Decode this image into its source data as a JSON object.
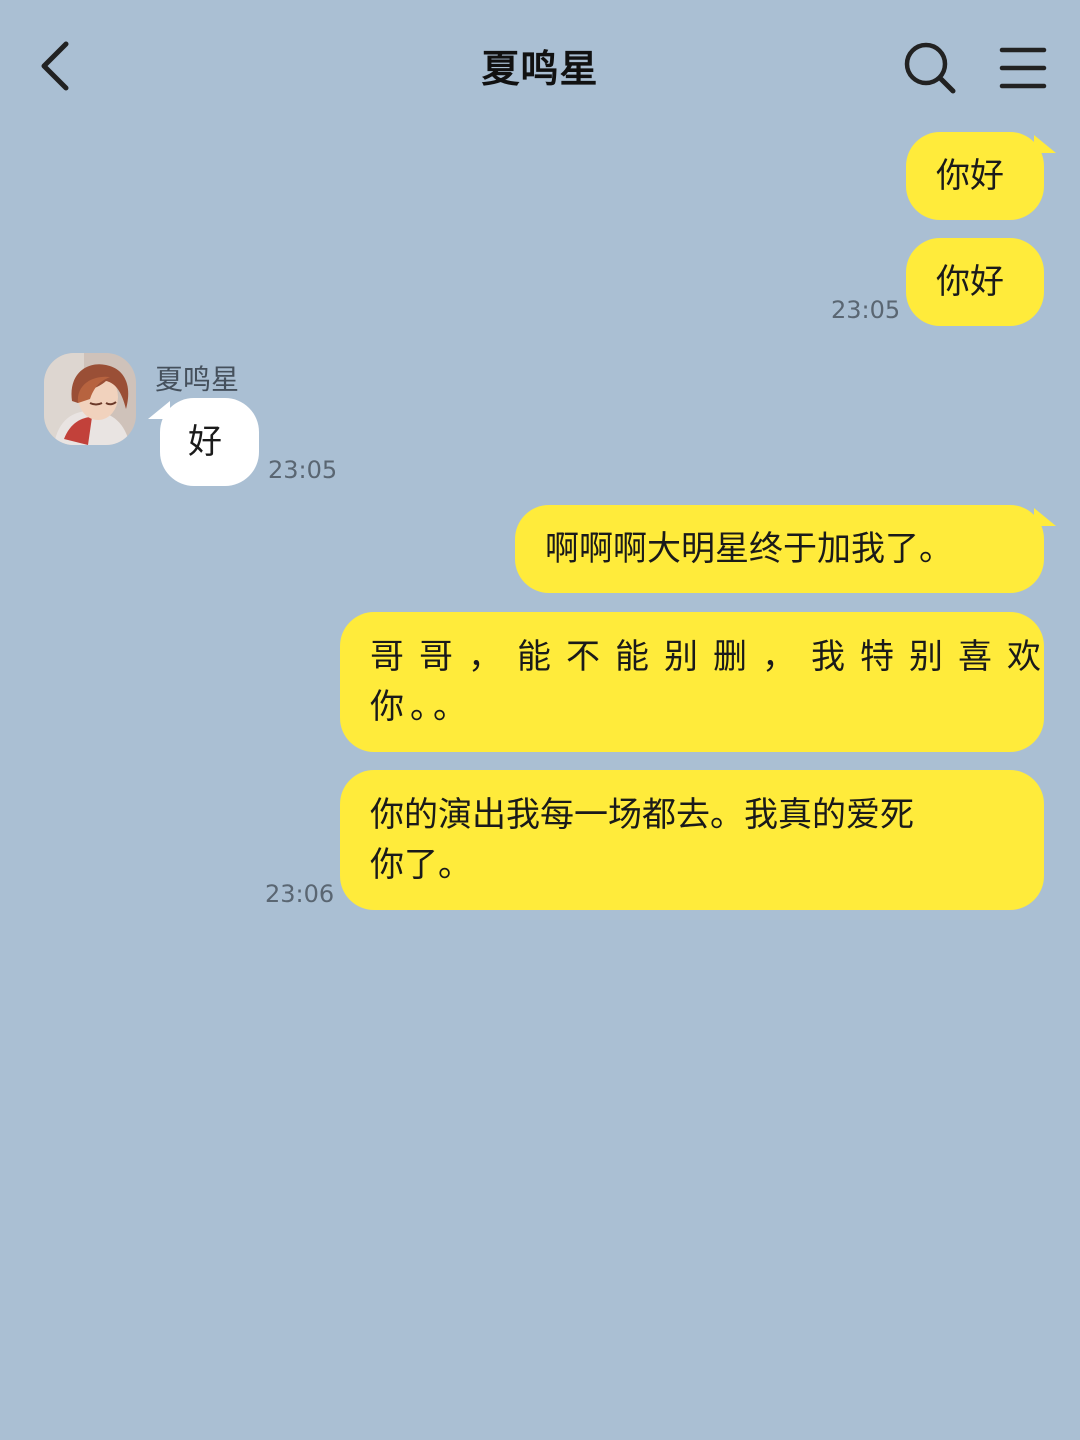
{
  "header": {
    "title": "夏鸣星",
    "back_icon": "chevron-left-icon",
    "search_icon": "search-icon",
    "menu_icon": "menu-icon"
  },
  "contact": {
    "name": "夏鸣星",
    "avatar": "anime-boy-avatar"
  },
  "messages": [
    {
      "sender": "me",
      "text": "你好",
      "time": ""
    },
    {
      "sender": "me",
      "text": "你好",
      "time": "23:05"
    },
    {
      "sender": "them",
      "text": "好",
      "time": "23:05"
    },
    {
      "sender": "me",
      "text": "啊啊啊大明星终于加我了。",
      "time": ""
    },
    {
      "sender": "me",
      "lines": [
        "哥哥，能不能别删，我特别喜欢",
        "你。。"
      ],
      "time": ""
    },
    {
      "sender": "me",
      "lines": [
        "你的演出我每一场都去。我真的爱死",
        "你了。"
      ],
      "time": "23:06"
    }
  ],
  "colors": {
    "background": "#aabfd3",
    "my_bubble": "#ffeb3b",
    "their_bubble": "#ffffff",
    "timestamp": "#5a6672"
  }
}
